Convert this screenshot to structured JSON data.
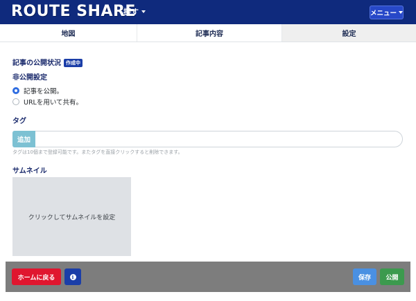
{
  "header": {
    "logo": "ROUTE SHARE",
    "explore_label": "探す",
    "menu_label": "メニュー"
  },
  "tabs": [
    {
      "label": "地図"
    },
    {
      "label": "記事内容"
    },
    {
      "label": "設定",
      "active": true
    }
  ],
  "publish_status": {
    "title": "記事の公開状況",
    "badge": "作成中"
  },
  "privacy": {
    "title": "非公開設定",
    "options": [
      {
        "label": "記事を公開。",
        "checked": true
      },
      {
        "label": "URLを用いて共有。",
        "checked": false
      }
    ]
  },
  "tags": {
    "title": "タグ",
    "add_label": "追加",
    "input_value": "",
    "input_placeholder": "",
    "help": "タグは10個まで登録可能です。またタグを直接クリックすると削除できます。"
  },
  "thumbnail": {
    "title": "サムネイル",
    "placeholder": "クリックしてサムネイルを設定"
  },
  "bottom_bar": {
    "home_label": "ホームに戻る",
    "info_icon": "i",
    "save_label": "保存",
    "publish_label": "公開"
  },
  "colors": {
    "header_bg": "#0f2a7d",
    "accent_blue": "#2f6de1",
    "home_red": "#e0162f",
    "publish_green": "#3c9a4e"
  }
}
